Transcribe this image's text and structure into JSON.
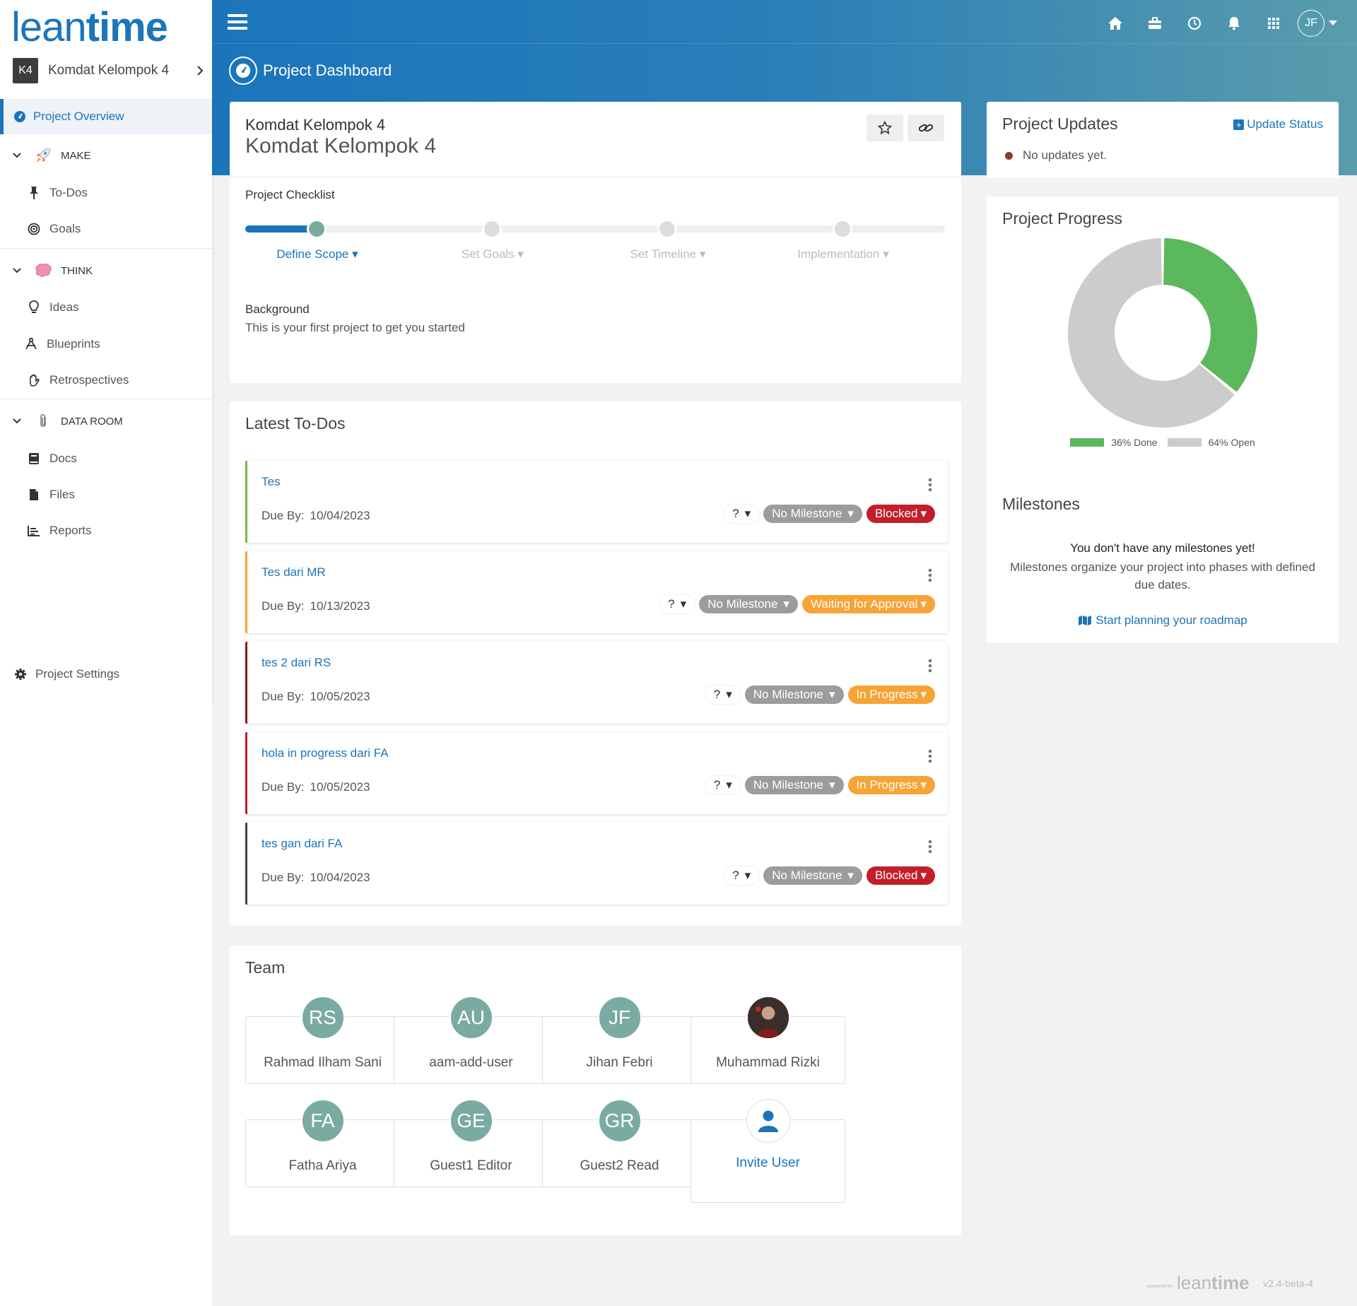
{
  "app": {
    "logo_text": "leantime",
    "version": "v2.4-beta-4",
    "powered_by": "powered by"
  },
  "header": {
    "icons": [
      "home-icon",
      "briefcase-icon",
      "clock-icon",
      "bell-icon",
      "apps-grid-icon"
    ],
    "user_initials": "JF",
    "page_title": "Project Dashboard"
  },
  "sidebar": {
    "project_badge": "K4",
    "project_name": "Komdat Kelompok 4",
    "overview_label": "Project Overview",
    "groups": [
      {
        "label": "MAKE",
        "items": [
          "To-Dos",
          "Goals"
        ]
      },
      {
        "label": "THINK",
        "items": [
          "Ideas",
          "Blueprints",
          "Retrospectives"
        ]
      },
      {
        "label": "DATA ROOM",
        "items": [
          "Docs",
          "Files",
          "Reports"
        ]
      }
    ],
    "settings_label": "Project Settings"
  },
  "project": {
    "title_small": "Komdat Kelompok 4",
    "title_large": "Komdat Kelompok 4",
    "checklist_label": "Project Checklist",
    "steps": [
      "Define Scope",
      "Set Goals",
      "Set Timeline",
      "Implementation"
    ],
    "active_step": 0,
    "background_label": "Background",
    "background_text": "This is your first project to get you started"
  },
  "todos": {
    "title": "Latest To-Dos",
    "due_label": "Due By:",
    "items": [
      {
        "name": "Tes",
        "due": "10/04/2023",
        "effort": "?",
        "milestone": "No Milestone",
        "status": "Blocked",
        "status_color": "#c41d2b",
        "border": "#7ab648"
      },
      {
        "name": "Tes dari MR",
        "due": "10/13/2023",
        "effort": "?",
        "milestone": "No Milestone",
        "status": "Waiting for Approval",
        "status_color": "#f7a335",
        "border": "#f7a335"
      },
      {
        "name": "tes 2 dari RS",
        "due": "10/05/2023",
        "effort": "?",
        "milestone": "No Milestone",
        "status": "In Progress",
        "status_color": "#f7a335",
        "border": "#8b1a1a"
      },
      {
        "name": "hola in progress dari FA",
        "due": "10/05/2023",
        "effort": "?",
        "milestone": "No Milestone",
        "status": "In Progress",
        "status_color": "#f7a335",
        "border": "#c41d2b"
      },
      {
        "name": "tes gan dari FA",
        "due": "10/04/2023",
        "effort": "?",
        "milestone": "No Milestone",
        "status": "Blocked",
        "status_color": "#c41d2b",
        "border": "#444444"
      }
    ]
  },
  "team": {
    "title": "Team",
    "members": [
      {
        "initials": "RS",
        "name": "Rahmad Ilham Sani"
      },
      {
        "initials": "AU",
        "name": "aam-add-user"
      },
      {
        "initials": "JF",
        "name": "Jihan Febri"
      },
      {
        "initials": "",
        "name": "Muhammad Rizki",
        "photo": true
      },
      {
        "initials": "FA",
        "name": "Fatha Ariya"
      },
      {
        "initials": "GE",
        "name": "Guest1 Editor"
      },
      {
        "initials": "GR",
        "name": "Guest2 Read"
      }
    ],
    "invite_label": "Invite User"
  },
  "updates": {
    "title": "Project Updates",
    "action_label": "Update Status",
    "empty_text": "No updates yet."
  },
  "progress": {
    "title": "Project Progress",
    "done_pct": 36,
    "open_pct": 64,
    "done_label": "36% Done",
    "open_label": "64% Open",
    "done_color": "#5cb85c",
    "open_color": "#cccccc"
  },
  "milestones": {
    "title": "Milestones",
    "empty_heading": "You don't have any milestones yet!",
    "empty_text": "Milestones organize your project into phases with defined due dates.",
    "link_label": "Start planning your roadmap"
  },
  "colors": {
    "accent": "#1b75bb",
    "avatar": "#7aaba2"
  }
}
